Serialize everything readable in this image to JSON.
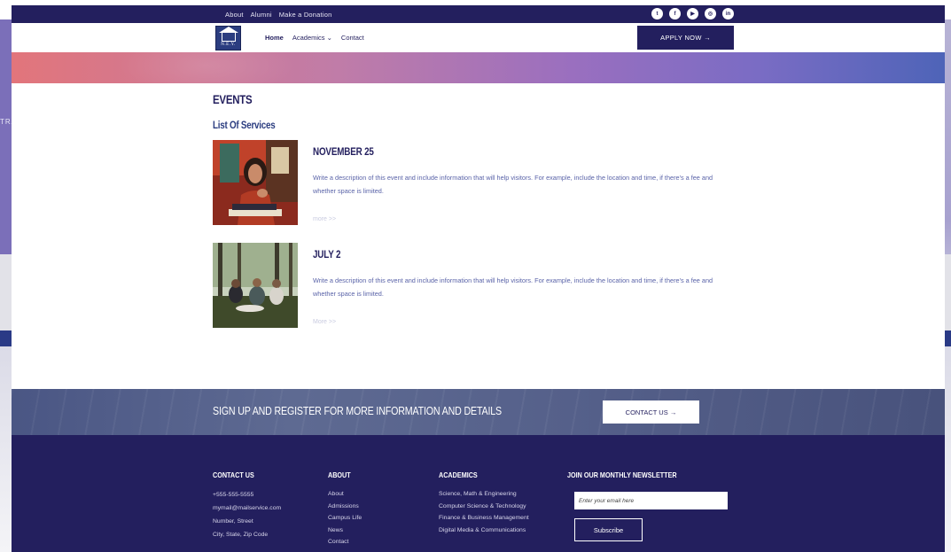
{
  "topbar": {
    "links": [
      "About",
      "Alumni",
      "Make a Donation"
    ],
    "socials": [
      {
        "icon": "twitter-icon",
        "glyph": "t"
      },
      {
        "icon": "facebook-icon",
        "glyph": "f"
      },
      {
        "icon": "youtube-icon",
        "glyph": "▶"
      },
      {
        "icon": "instagram-icon",
        "glyph": "◎"
      },
      {
        "icon": "linkedin-icon",
        "glyph": "in"
      }
    ]
  },
  "logo": {
    "text": "N.E.Y."
  },
  "nav": {
    "home": "Home",
    "academics": "Academics  ⌄",
    "contact": "Contact",
    "apply": "APPLY NOW →"
  },
  "background": {
    "side_text": "TRA"
  },
  "content": {
    "title": "EVENTS",
    "subtitle": "List Of Services",
    "events": [
      {
        "date": "NOVEMBER 25",
        "description": "Write a description of this event and include information that will help visitors. For example, include the location and time, if there's a fee and whether space is limited.",
        "more": "more  >>"
      },
      {
        "date": "JULY 2",
        "description": "Write a description of this event and include information that will help visitors. For example, include the location and time, if there's a fee and whether space is limited.",
        "more": "More  >>"
      }
    ]
  },
  "signup": {
    "text": "SIGN UP AND REGISTER FOR MORE INFORMATION AND DETAILS",
    "button": "CONTACT US →"
  },
  "footer": {
    "contact": {
      "heading": "CONTACT US",
      "items": [
        "+555-555-5555",
        "mymail@mailservice.com",
        "Number, Street",
        "City, State, Zip Code"
      ]
    },
    "about": {
      "heading": "ABOUT",
      "items": [
        "About",
        "Admissions",
        "Campus Life",
        "News",
        "Contact"
      ]
    },
    "academics": {
      "heading": "ACADEMICS",
      "items": [
        "Science, Math & Engineering",
        "Computer Science & Technology",
        "Finance & Business Management",
        "Digital Media & Communications"
      ]
    },
    "newsletter": {
      "heading": "JOIN OUR MONTHLY NEWSLETTER",
      "placeholder": "Enter your email here",
      "button": "Subscribe"
    }
  },
  "colors": {
    "navy": "#231f5e",
    "accent_blue": "#2b3d80",
    "text_blue": "#5a63a8"
  }
}
